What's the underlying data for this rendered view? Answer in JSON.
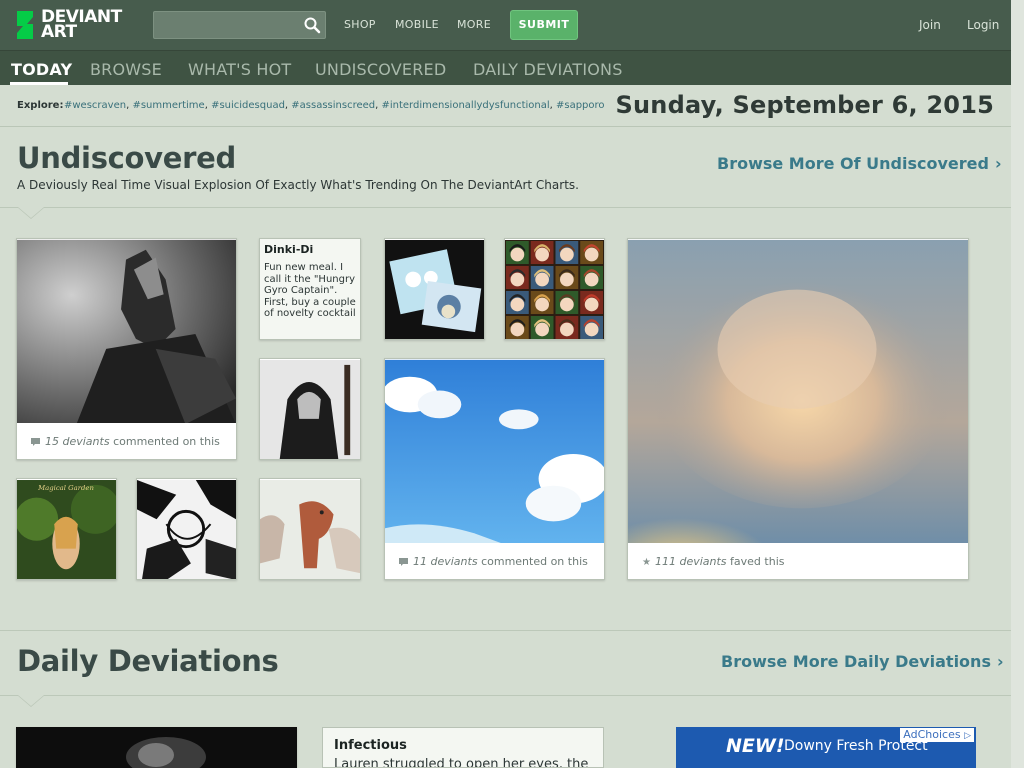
{
  "logo": {
    "line1": "DEVIANT",
    "line2": "ART"
  },
  "search": {
    "placeholder": ""
  },
  "topnav": {
    "shop": "SHOP",
    "mobile": "MOBILE",
    "more": "MORE",
    "submit": "SUBMIT",
    "join": "Join",
    "login": "Login"
  },
  "tabs": [
    "TODAY",
    "BROWSE",
    "WHAT'S HOT",
    "UNDISCOVERED",
    "DAILY DEVIATIONS"
  ],
  "explore": {
    "label": "Explore:",
    "tags": [
      "#wescraven",
      "#summertime",
      "#suicidesquad",
      "#assassinscreed",
      "#interdimensionallydysfunctional",
      "#sapporo"
    ]
  },
  "date": "Sunday, September 6, 2015",
  "undiscovered": {
    "title": "Undiscovered",
    "subtitle": "A Deviously Real Time Visual Explosion Of Exactly What's Trending On The DeviantArt Charts.",
    "browse_more": "Browse More Of Undiscovered",
    "card_text": {
      "title": "Dinki-Di",
      "body": "Fun new meal. I call it the \"Hungry Gyro Captain\". First, buy a couple of novelty cocktail"
    },
    "meta": [
      {
        "count": "15 deviants",
        "suffix": " commented on this"
      },
      {
        "count": "11 deviants",
        "suffix": " commented on this"
      },
      {
        "count": "111 deviants",
        "suffix": " faved this"
      }
    ],
    "garden_caption": "Magical Garden"
  },
  "daily": {
    "title": "Daily Deviations",
    "browse_more": "Browse More Daily Deviations",
    "card_title": "Infectious",
    "card_body": "Lauren struggled to open her eyes, the"
  },
  "ad": {
    "choices": "AdChoices",
    "new": "NEW!",
    "text": "Downy Fresh Protect"
  },
  "colors": {
    "topbar": "#475c4d",
    "accent": "#5ab26a",
    "link": "#3a7a8a",
    "background": "#d4ddd1"
  }
}
